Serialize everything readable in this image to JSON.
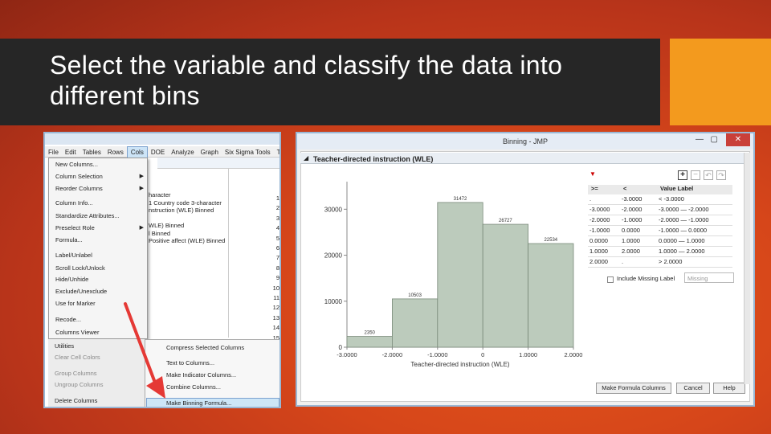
{
  "slide": {
    "title": "Select the variable and classify the data into different bins"
  },
  "left_screenshot": {
    "menu": [
      "File",
      "Edit",
      "Tables",
      "Rows",
      "Cols",
      "DOE",
      "Analyze",
      "Graph",
      "Six Sigma Tools",
      "Tools"
    ],
    "active_menu": "Cols",
    "dropdown_items": [
      {
        "label": "New Columns...",
        "arrow": ""
      },
      {
        "label": "Column Selection",
        "arrow": "▶"
      },
      {
        "label": "Reorder Columns",
        "arrow": "▶"
      },
      {
        "label": "Column Info...",
        "arrow": ""
      },
      {
        "label": "Standardize Attributes...",
        "arrow": ""
      },
      {
        "label": "Preselect Role",
        "arrow": "▶"
      },
      {
        "label": "Formula...",
        "arrow": ""
      },
      {
        "label": "Label/Unlabel",
        "arrow": ""
      },
      {
        "label": "Scroll Lock/Unlock",
        "arrow": ""
      },
      {
        "label": "Hide/Unhide",
        "arrow": ""
      },
      {
        "label": "Exclude/Unexclude",
        "arrow": ""
      },
      {
        "label": "Use for Marker",
        "arrow": ""
      },
      {
        "label": "Recode...",
        "arrow": ""
      },
      {
        "label": "Columns Viewer",
        "arrow": ""
      }
    ],
    "grey_items": [
      "Utilities",
      "Clear Cell Colors",
      "Group Columns",
      "Ungroup Columns",
      "Delete Columns"
    ],
    "submenu_items": [
      "Compress Selected Columns",
      "Text to Columns...",
      "Make Indicator Columns...",
      "Combine Columns...",
      "Make Binning Formula..."
    ],
    "column_items": [
      "haracter",
      "1 Country code 3-character",
      "nstruction (WLE) Binned",
      "",
      "WLE) Binned",
      "l Binned",
      "Positive affect (WLE) Binned"
    ],
    "row_numbers": [
      "1",
      "2",
      "3",
      "4",
      "5",
      "6",
      "7",
      "8",
      "9",
      "10",
      "11",
      "12",
      "13",
      "14",
      "15"
    ]
  },
  "right_screenshot": {
    "window_title": "Binning - JMP",
    "outline_title": "Teacher-directed instruction (WLE)",
    "table_headers": [
      ">=",
      "<",
      "Value Label"
    ],
    "table_rows": [
      [
        ".",
        "-3.0000",
        "< -3.0000"
      ],
      [
        "-3.0000",
        "-2.0000",
        "-3.0000 — -2.0000"
      ],
      [
        "-2.0000",
        "-1.0000",
        "-2.0000 — -1.0000"
      ],
      [
        "-1.0000",
        "0.0000",
        "-1.0000 — 0.0000"
      ],
      [
        "0.0000",
        "1.0000",
        "0.0000 — 1.0000"
      ],
      [
        "1.0000",
        "2.0000",
        "1.0000 — 2.0000"
      ],
      [
        "2.0000",
        ".",
        "> 2.0000"
      ]
    ],
    "include_missing": "Include Missing Label",
    "missing_placeholder": "Missing",
    "buttons": [
      "Make Formula Columns",
      "Cancel",
      "Help"
    ]
  },
  "chart_data": {
    "type": "bar",
    "categories": [
      "-3.0000 to -2.0000",
      "-2.0000 to -1.0000",
      "-1.0000 to 0",
      "0 to 1.0000",
      "1.0000 to 2.0000"
    ],
    "bin_edges": [
      "-3.0000",
      "-2.0000",
      "-1.0000",
      "0",
      "1.0000",
      "2.0000"
    ],
    "values": [
      2350,
      10503,
      31472,
      26727,
      22534
    ],
    "data_labels": [
      "2350",
      "10503",
      "31472",
      "26727",
      "22534"
    ],
    "xlabel": "Teacher-directed instruction (WLE)",
    "ylabel": "",
    "yticks": [
      0,
      10000,
      20000,
      30000
    ],
    "ylim": [
      0,
      36000
    ],
    "bar_color": "#bccbbc",
    "bar_stroke": "#7a8a7a"
  }
}
